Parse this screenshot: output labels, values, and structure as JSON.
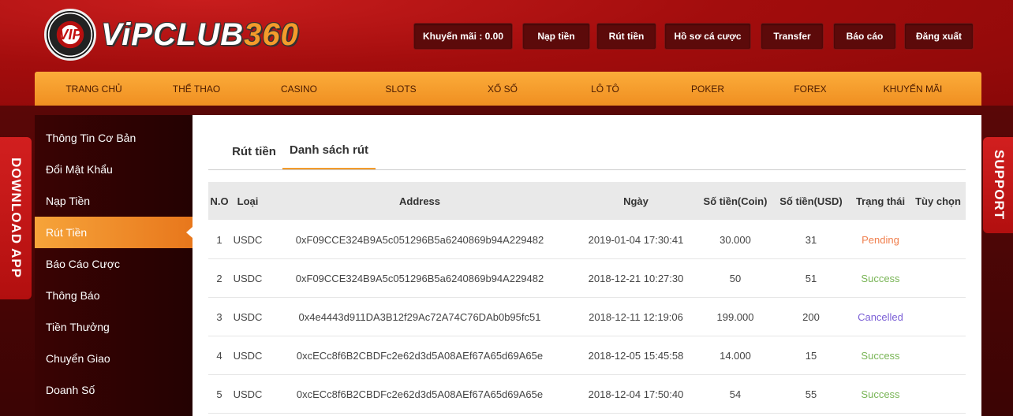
{
  "brand": {
    "chip_text": "VIP",
    "logo_word": "ViPCLUB",
    "logo_num": "360"
  },
  "top_buttons": [
    {
      "label": "Khuyến mãi : 0.00"
    },
    {
      "label": "Nạp tiền"
    },
    {
      "label": "Rút tiền"
    },
    {
      "label": "Hồ sơ cá cược"
    },
    {
      "label": "Transfer"
    },
    {
      "label": "Báo cáo"
    },
    {
      "label": "Đăng xuất"
    }
  ],
  "nav": [
    "TRANG CHỦ",
    "THỂ THAO",
    "CASINO",
    "SLOTS",
    "XỔ SỐ",
    "LÔ TÔ",
    "POKER",
    "FOREX",
    "KHUYẾN MÃI"
  ],
  "sidebar": [
    "Thông Tin Cơ Bản",
    "Đổi Mật Khẩu",
    "Nạp Tiền",
    "Rút Tiền",
    "Báo Cáo Cược",
    "Thông Báo",
    "Tiền Thưởng",
    "Chuyển Giao",
    "Doanh Số"
  ],
  "sidebar_active": "Rút Tiền",
  "tabs": [
    "Rút tiền",
    "Danh sách rút"
  ],
  "active_tab": "Danh sách rút",
  "table": {
    "headers": [
      "N.O",
      "Loại",
      "Address",
      "Ngày",
      "Số tiền(Coin)",
      "Số tiền(USD)",
      "Trạng thái",
      "Tùy chọn"
    ],
    "rows": [
      [
        "1",
        "USDC",
        "0xF09CCE324B9A5c051296B5a6240869b94A229482",
        "2019-01-04 17:30:41",
        "30.000",
        "31",
        "Pending",
        ""
      ],
      [
        "2",
        "USDC",
        "0xF09CCE324B9A5c051296B5a6240869b94A229482",
        "2018-12-21 10:27:30",
        "50",
        "51",
        "Success",
        ""
      ],
      [
        "3",
        "USDC",
        "0x4e4443d911DA3B12f29Ac72A74C76DAb0b95fc51",
        "2018-12-11 12:19:06",
        "199.000",
        "200",
        "Cancelled",
        ""
      ],
      [
        "4",
        "USDC",
        "0xcECc8f6B2CBDFc2e62d3d5A08AEf67A65d69A65e",
        "2018-12-05 15:45:58",
        "14.000",
        "15",
        "Success",
        ""
      ],
      [
        "5",
        "USDC",
        "0xcECc8f6B2CBDFc2e62d3d5A08AEf67A65d69A65e",
        "2018-12-04 17:50:40",
        "54",
        "55",
        "Success",
        ""
      ]
    ]
  },
  "status_colors": {
    "Pending": "#f07f4d",
    "Success": "#79b556",
    "Cancelled": "#7b5fd6"
  },
  "float_left": "DOWNLOAD APP",
  "float_right": "SUPPORT",
  "colors": {
    "header_red": "#a30d0d",
    "nav_orange": "#f39b2b",
    "sidebar_dark": "#300303"
  }
}
